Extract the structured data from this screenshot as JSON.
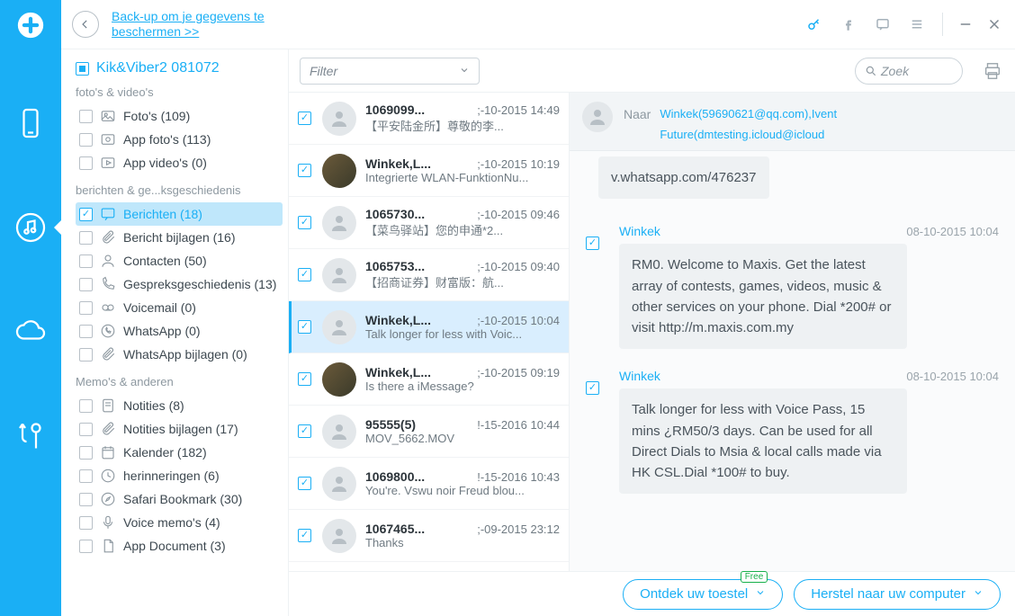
{
  "topbar": {
    "backup_link": "Back-up om je gegevens te beschermen >>"
  },
  "tree": {
    "title": "Kik&Viber2 081072",
    "sections": {
      "media_label": "foto's & video's",
      "media": [
        {
          "label": "Foto's (109)"
        },
        {
          "label": "App foto's (113)"
        },
        {
          "label": "App video's (0)"
        }
      ],
      "msg_label": "berichten & ge...ksgeschiedenis",
      "msg": [
        {
          "label": "Berichten (18)",
          "selected": true
        },
        {
          "label": "Bericht bijlagen (16)"
        },
        {
          "label": "Contacten (50)"
        },
        {
          "label": "Gespreksgeschiedenis (13)"
        },
        {
          "label": "Voicemail (0)"
        },
        {
          "label": "WhatsApp (0)"
        },
        {
          "label": "WhatsApp bijlagen (0)"
        }
      ],
      "memo_label": "Memo's & anderen",
      "memo": [
        {
          "label": "Notities (8)"
        },
        {
          "label": "Notities bijlagen (17)"
        },
        {
          "label": "Kalender (182)"
        },
        {
          "label": "herinneringen (6)"
        },
        {
          "label": "Safari Bookmark (30)"
        },
        {
          "label": "Voice memo's (4)"
        },
        {
          "label": "App Document (3)"
        }
      ]
    }
  },
  "filter": {
    "placeholder": "Filter",
    "search_placeholder": "Zoek"
  },
  "messages": [
    {
      "name": "1069099...",
      "date": ";-10-2015 14:49",
      "preview": "【平安陆金所】尊敬的李...",
      "photo": false
    },
    {
      "name": "Winkek,L...",
      "date": ";-10-2015 10:19",
      "preview": "Integrierte WLAN-FunktionNu...",
      "photo": true
    },
    {
      "name": "1065730...",
      "date": ";-10-2015 09:46",
      "preview": "【菜鸟驿站】您的申通*2...",
      "photo": false
    },
    {
      "name": "1065753...",
      "date": ";-10-2015 09:40",
      "preview": "【招商证券】财富版：航...",
      "photo": false
    },
    {
      "name": "Winkek,L...",
      "date": ";-10-2015 10:04",
      "preview": "Talk longer for less with Voic...",
      "photo": false,
      "selected": true
    },
    {
      "name": "Winkek,L...",
      "date": ";-10-2015 09:19",
      "preview": "Is there a iMessage?",
      "photo": true
    },
    {
      "name": "95555(5)",
      "date": "!-15-2016 10:44",
      "preview": "MOV_5662.MOV",
      "photo": false
    },
    {
      "name": "1069800...",
      "date": "!-15-2016 10:43",
      "preview": "You're. Vswu noir Freud blou...",
      "photo": false
    },
    {
      "name": "1067465...",
      "date": ";-09-2015 23:12",
      "preview": "Thanks",
      "photo": false
    }
  ],
  "detail": {
    "naar_label": "Naar",
    "naar_links": [
      "Winkek(59690621@qq.com),Ivent",
      "Future(dmtesting.icloud@icloud"
    ],
    "orphan_bubble": "v.whatsapp.com/476237",
    "thread": [
      {
        "sender": "Winkek",
        "date": "08-10-2015 10:04",
        "body": "RM0. Welcome to Maxis. Get the latest array of contests,  games, videos, music & other services on your phone. Dial *200# or visit http://m.maxis.com.my"
      },
      {
        "sender": "Winkek",
        "date": "08-10-2015 10:04",
        "body": "Talk longer for less with Voice Pass, 15 mins ¿RM50/3 days. Can be used for all Direct Dials to Msia & local calls made via HK CSL.Dial *100# to buy."
      }
    ]
  },
  "bottom": {
    "discover": "Ontdek uw toestel",
    "free_badge": "Free",
    "restore": "Herstel naar uw computer"
  }
}
